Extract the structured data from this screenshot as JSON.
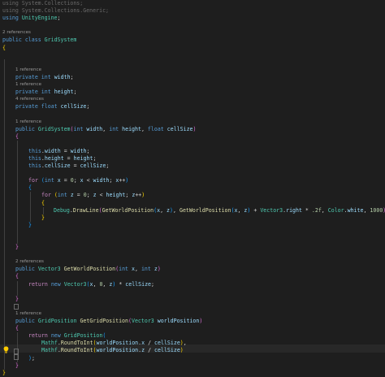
{
  "using1": "using System.Collections;",
  "using2": "using System.Collections.Generic;",
  "using3": "using UnityEngine;",
  "refs_class": "2 references",
  "class_public": "public",
  "class_kw": "class",
  "class_name": "GridSystem",
  "brace_open": "{",
  "brace_close": "}",
  "refs_width": "1 reference",
  "refs_height": "1 reference",
  "refs_cellsize": "4 references",
  "refs_ctor": "1 reference",
  "refs_getworld": "2 references",
  "refs_getgrid": "1 reference",
  "kw_private": "private",
  "kw_int": "int",
  "kw_float": "float",
  "kw_public": "public",
  "kw_this": "this",
  "kw_for": "for",
  "kw_return": "return",
  "kw_new": "new",
  "f_width": "width",
  "f_height": "height",
  "f_cellsize": "cellSize",
  "ty_vector3": "Vector3",
  "ty_gridposition": "GridPosition",
  "ty_debug": "Debug",
  "ty_color": "Color",
  "ty_mathf": "Mathf",
  "fn_drawline": "DrawLine",
  "fn_getworld": "GetWorldPosition",
  "fn_getgrid": "GetGridPosition",
  "fn_roundtoint": "RoundToInt",
  "id_x": "x",
  "id_z": "z",
  "id_worldposition": "worldPosition",
  "id_right": "right",
  "id_white": "white",
  "num_0": "0",
  "num_2f": ".2f",
  "num_1000": "1000",
  "lightbulb_icon": "lightbulb-icon",
  "colors": {
    "background": "#1e1e1e",
    "keyword": "#569cd6",
    "control": "#c586c0",
    "type": "#4ec9b0",
    "function": "#dcdcaa",
    "identifier": "#9cdcfe",
    "number": "#b5cea8",
    "codelens": "#999999"
  }
}
